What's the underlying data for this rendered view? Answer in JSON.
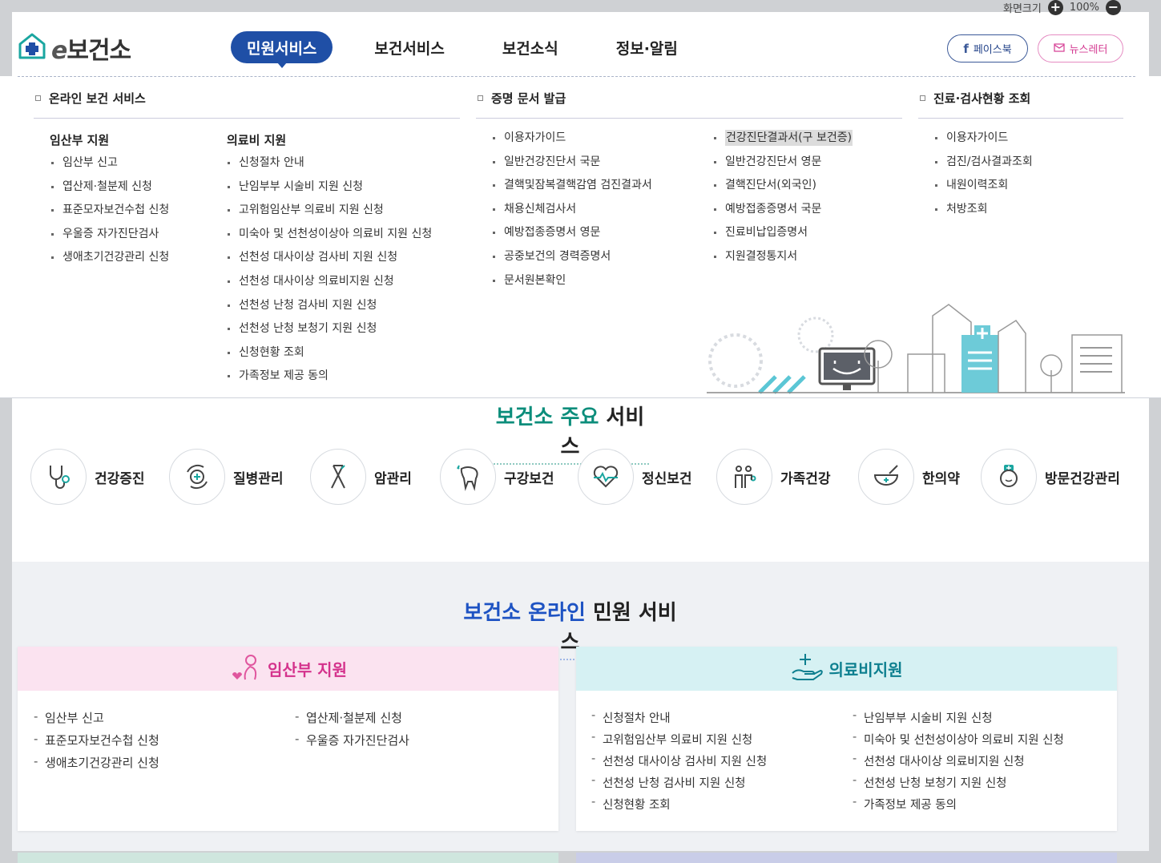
{
  "zoom": {
    "label": "화면크기",
    "value": "100%",
    "plus": "+",
    "minus": "−"
  },
  "header": {
    "logo_e": "e",
    "logo_text": "보건소",
    "nav": [
      "민원서비스",
      "보건서비스",
      "보건소식",
      "정보·알림"
    ],
    "facebook": "페이스북",
    "newsletter": "뉴스레터"
  },
  "mega": {
    "col1": {
      "title": "온라인 보건 서비스",
      "groups": [
        {
          "title": "임산부 지원",
          "items": [
            "임산부 신고",
            "엽산제·철분제 신청",
            "표준모자보건수첩 신청",
            "우울증 자가진단검사",
            "생애초기건강관리 신청"
          ]
        },
        {
          "title": "의료비 지원",
          "items": [
            "신청절차 안내",
            "난임부부 시술비 지원 신청",
            "고위험임산부 의료비 지원 신청",
            "미숙아 및 선천성이상아 의료비 지원 신청",
            "선천성 대사이상 검사비 지원 신청",
            "선천성 대사이상 의료비지원 신청",
            "선천성 난청 검사비 지원 신청",
            "선천성 난청 보청기 지원 신청",
            "신청현황 조회",
            "가족정보 제공 동의"
          ]
        }
      ]
    },
    "col2": {
      "title": "증명 문서 발급",
      "left": [
        "이용자가이드",
        "일반건강진단서 국문",
        "결핵및잠복결핵감염 검진결과서",
        "채용신체검사서",
        "예방접종증명서 영문",
        "공중보건의 경력증명서",
        "문서원본확인"
      ],
      "right": [
        "건강진단결과서(구 보건증)",
        "일반건강진단서 영문",
        "결핵진단서(외국인)",
        "예방접종증명서 국문",
        "진료비납입증명서",
        "지원결정통지서"
      ]
    },
    "col3": {
      "title": "진료·검사현황 조회",
      "items": [
        "이용자가이드",
        "검진/검사결과조회",
        "내원이력조회",
        "처방조회"
      ]
    }
  },
  "main_services": {
    "title_accent": "보건소 주요",
    "title_rest": " 서비스",
    "items": [
      {
        "label": "건강증진",
        "icon": "stethoscope-icon"
      },
      {
        "label": "질병관리",
        "icon": "virus-icon"
      },
      {
        "label": "암관리",
        "icon": "ribbon-icon"
      },
      {
        "label": "구강보건",
        "icon": "tooth-icon"
      },
      {
        "label": "정신보건",
        "icon": "heart-pulse-icon"
      },
      {
        "label": "가족건강",
        "icon": "family-icon"
      },
      {
        "label": "한의약",
        "icon": "herbal-bowl-icon"
      },
      {
        "label": "방문건강관리",
        "icon": "nurse-icon"
      }
    ]
  },
  "online": {
    "title_accent": "보건소 온라인",
    "title_rest": " 민원 서비스",
    "preg": {
      "title": "임산부 지원",
      "left": [
        "임산부 신고",
        "표준모자보건수첩 신청",
        "생애초기건강관리 신청"
      ],
      "right": [
        "엽산제·철분제 신청",
        "우울증 자가진단검사"
      ]
    },
    "med": {
      "title": "의료비지원",
      "left": [
        "신청절차 안내",
        "고위험임산부 의료비 지원 신청",
        "선천성 대사이상 검사비 지원 신청",
        "선천성 난청 검사비 지원 신청",
        "신청현황 조회"
      ],
      "right": [
        "난임부부 시술비 지원 신청",
        "미숙아 및 선천성이상아 의료비 지원 신청",
        "선천성 대사이상 의료비지원 신청",
        "선천성 난청 보청기 지원 신청",
        "가족정보 제공 동의"
      ]
    }
  },
  "colors": {
    "nav_active": "#1f4fa6",
    "accent_green": "#0b8d7b",
    "accent_blue": "#1e53c3",
    "pink": "#d4328c",
    "teal": "#0d7f8f"
  }
}
